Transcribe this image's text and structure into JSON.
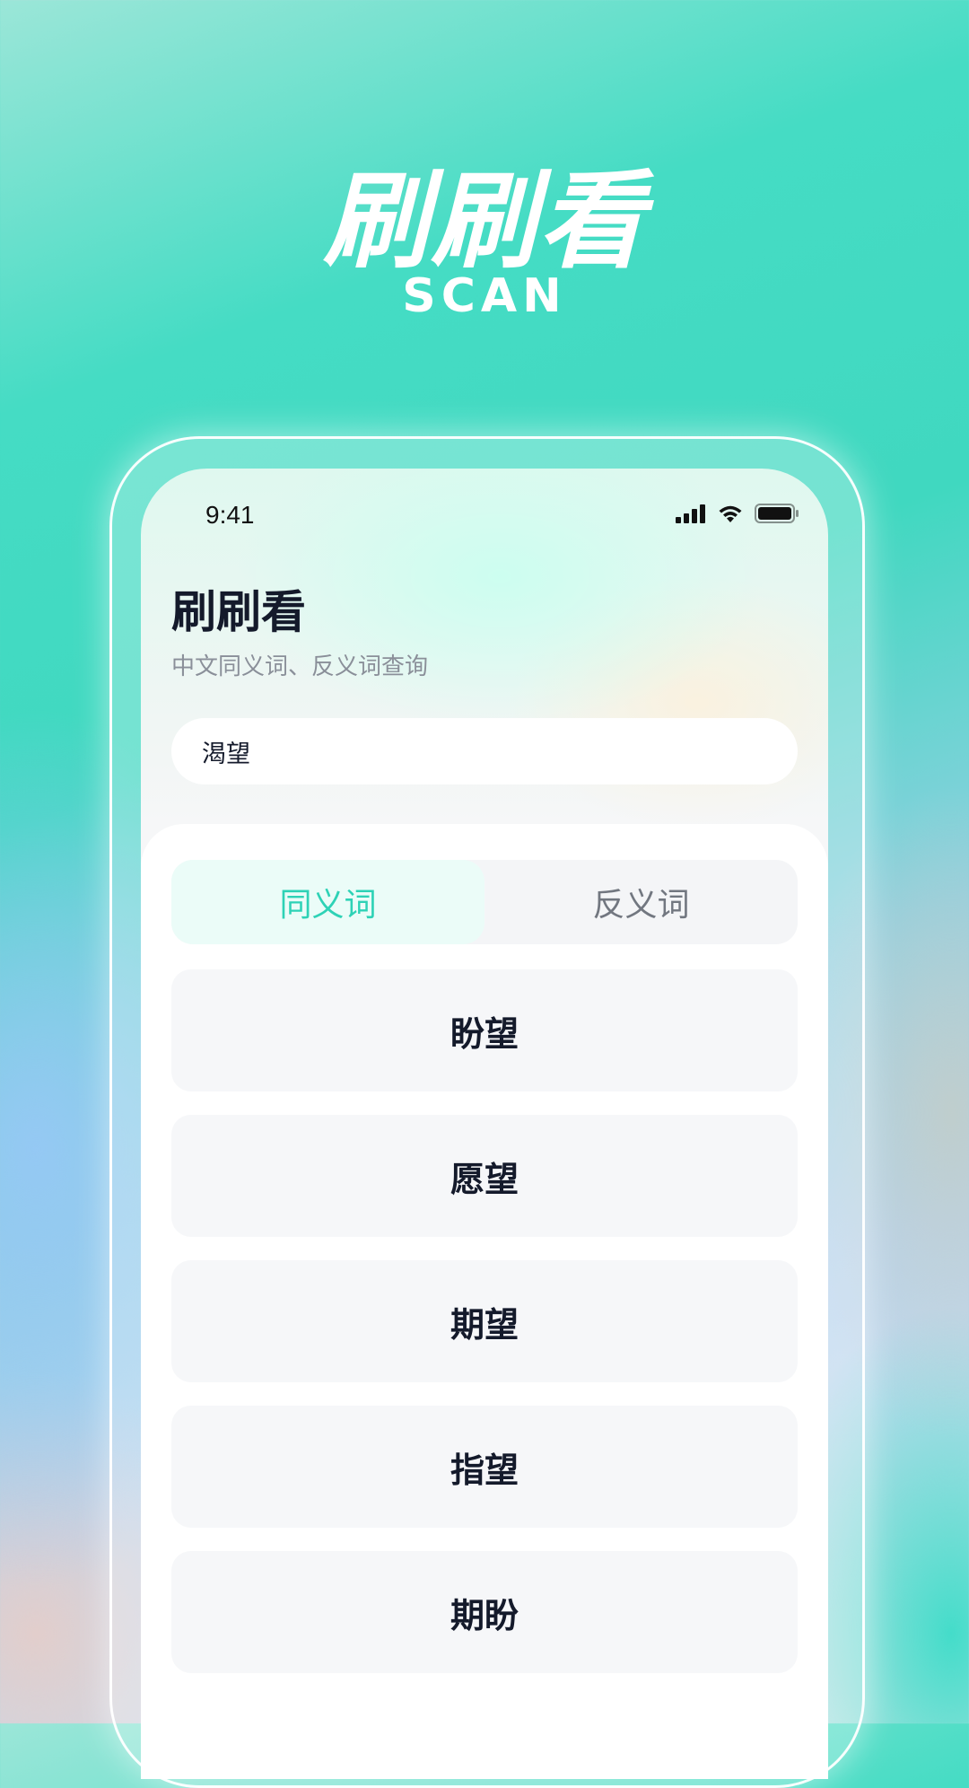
{
  "hero": {
    "title": "刷刷看",
    "subtitle": "SCAN"
  },
  "status_bar": {
    "time": "9:41"
  },
  "app": {
    "title": "刷刷看",
    "subtitle": "中文同义词、反义词查询"
  },
  "search": {
    "value": "渴望"
  },
  "tabs": [
    {
      "label": "同义词",
      "active": true
    },
    {
      "label": "反义词",
      "active": false
    }
  ],
  "results": [
    "盼望",
    "愿望",
    "期望",
    "指望",
    "期盼"
  ],
  "colors": {
    "accent": "#2ed2b6",
    "text_dark": "#141a2b",
    "text_muted": "#8a8f99"
  },
  "icons": [
    "signal-icon",
    "wifi-icon",
    "battery-icon"
  ]
}
